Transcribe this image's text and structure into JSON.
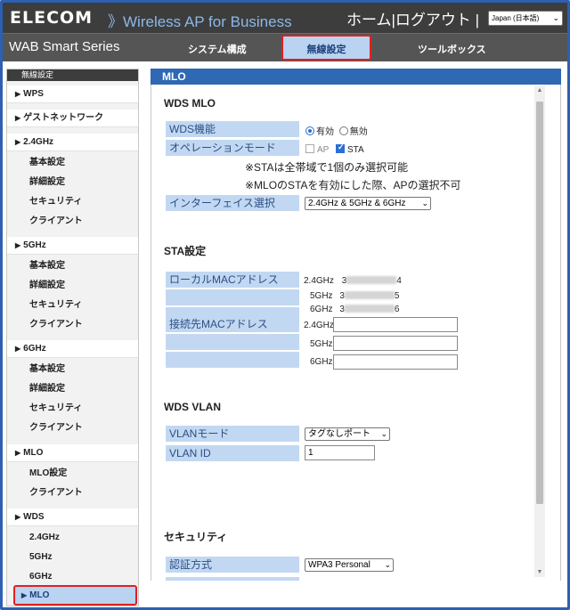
{
  "header": {
    "logo": "ELECOM",
    "product": "》Wireless AP for Business",
    "home": "ホーム",
    "separator": "|",
    "logout": "ログアウト",
    "separator2": "|",
    "language": "Japan (日本語)"
  },
  "nav": {
    "series": "WAB Smart Series",
    "tabs": [
      "システム構成",
      "無線設定",
      "ツールボックス"
    ],
    "active_tab": "無線設定"
  },
  "sidebar": {
    "header": "無線設定",
    "sections": {
      "wps": "WPS",
      "guest": "ゲストネットワーク",
      "band24": "2.4GHz",
      "band5": "5GHz",
      "band6": "6GHz",
      "mlo": "MLO",
      "wds": "WDS"
    },
    "band_items": [
      "基本設定",
      "詳細設定",
      "セキュリティ",
      "クライアント"
    ],
    "mlo_items": [
      "MLO設定",
      "クライアント"
    ],
    "wds_items": [
      "2.4GHz",
      "5GHz",
      "6GHz"
    ],
    "active": "MLO"
  },
  "panel": {
    "title": "MLO",
    "wds_mlo": {
      "title": "WDS MLO",
      "wds_function_label": "WDS機能",
      "radio_on": "有効",
      "radio_off": "無効",
      "wds_enabled": true,
      "op_mode_label": "オペレーションモード",
      "mode_ap": "AP",
      "mode_sta": "STA",
      "ap_checked": false,
      "sta_checked": true,
      "note1": "※STAは全帯域で1個のみ選択可能",
      "note2": "※MLOのSTAを有効にした際、APの選択不可",
      "interface_label": "インターフェイス選択",
      "interface_value": "2.4GHz & 5GHz & 6GHz"
    },
    "sta": {
      "title": "STA設定",
      "local_mac_label": "ローカルMACアドレス",
      "local_mac": [
        {
          "band": "2.4GHz",
          "prefix": "3",
          "suffix": "4"
        },
        {
          "band": "5GHz",
          "prefix": "3",
          "suffix": "5"
        },
        {
          "band": "6GHz",
          "prefix": "3",
          "suffix": "6"
        }
      ],
      "remote_mac_label": "接続先MACアドレス",
      "remote_bands": [
        "2.4GHz",
        "5GHz",
        "6GHz"
      ]
    },
    "wds_vlan": {
      "title": "WDS VLAN",
      "mode_label": "VLANモード",
      "mode_value": "タグなしポート",
      "id_label": "VLAN ID",
      "id_value": "1"
    },
    "security": {
      "title": "セキュリティ",
      "auth_label": "認証方式",
      "auth_value": "WPA3 Personal"
    }
  },
  "colors": {
    "header_bg": "#3d3d3d",
    "nav_bg": "#555555",
    "accent_blue": "#2f68b3",
    "label_bg": "#c2d8f2",
    "active_outline": "#e02020"
  }
}
